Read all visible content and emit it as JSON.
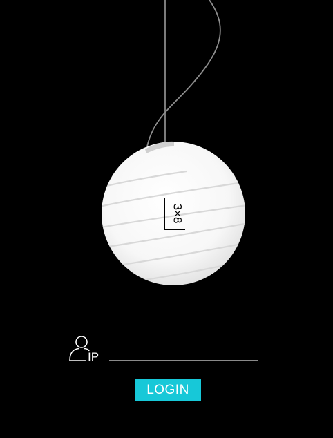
{
  "login": {
    "ip_label": "IP",
    "ip_value": "",
    "button_label": "LOGIN"
  },
  "brand": {
    "logo_text": "3×8"
  },
  "colors": {
    "background": "#000000",
    "button": "#17c8d8",
    "underline": "#8a8a8a"
  },
  "icons": [
    "pendant-lamp-illustration",
    "user-icon"
  ]
}
